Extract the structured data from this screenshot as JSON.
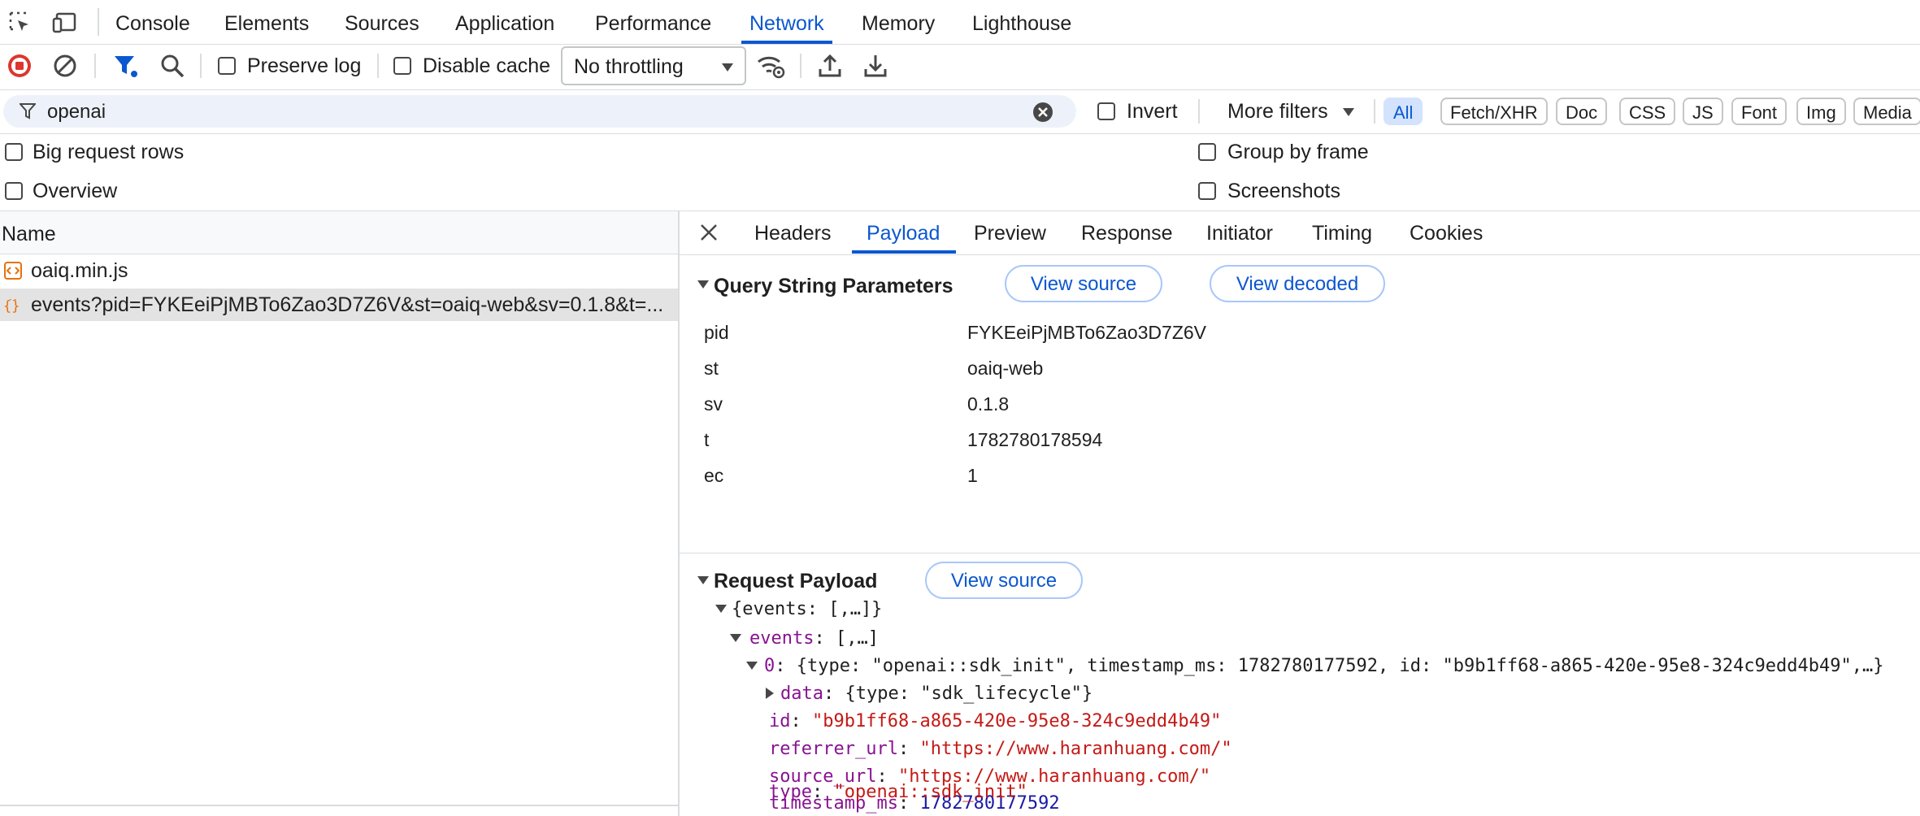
{
  "top_tabs": [
    {
      "label": "Console"
    },
    {
      "label": "Elements"
    },
    {
      "label": "Sources"
    },
    {
      "label": "Application"
    },
    {
      "label": "Performance"
    },
    {
      "label": "Network",
      "active": true
    },
    {
      "label": "Memory"
    },
    {
      "label": "Lighthouse"
    }
  ],
  "toolbar": {
    "preserve_log": "Preserve log",
    "disable_cache": "Disable cache",
    "throttling": "No throttling",
    "preserve_checked": false,
    "disable_cache_checked": false
  },
  "filter": {
    "value": "openai",
    "invert_label": "Invert",
    "more_filters_label": "More filters",
    "types": [
      "All",
      "Fetch/XHR",
      "Doc",
      "CSS",
      "JS",
      "Font",
      "Img",
      "Media"
    ],
    "active_type": "All"
  },
  "options": {
    "big_request_rows": "Big request rows",
    "overview": "Overview",
    "group_by_frame": "Group by frame",
    "screenshots": "Screenshots"
  },
  "request_list": {
    "header": "Name",
    "rows": [
      {
        "name": "oaiq.min.js",
        "selected": false
      },
      {
        "name": "events?pid=FYKEeiPjMBTo6Zao3D7Z6V&st=oaiq-web&sv=0.1.8&t=...",
        "selected": true
      }
    ]
  },
  "detail_tabs": [
    {
      "label": "Headers"
    },
    {
      "label": "Payload",
      "active": true
    },
    {
      "label": "Preview"
    },
    {
      "label": "Response"
    },
    {
      "label": "Initiator"
    },
    {
      "label": "Timing"
    },
    {
      "label": "Cookies"
    }
  ],
  "query_string": {
    "title": "Query String Parameters",
    "view_source": "View source",
    "view_decoded": "View decoded",
    "params": [
      {
        "key": "pid",
        "value": "FYKEeiPjMBTo6Zao3D7Z6V"
      },
      {
        "key": "st",
        "value": "oaiq-web"
      },
      {
        "key": "sv",
        "value": "0.1.8"
      },
      {
        "key": "t",
        "value": "1782780178594"
      },
      {
        "key": "ec",
        "value": "1"
      }
    ]
  },
  "request_payload": {
    "title": "Request Payload",
    "view_source": "View source",
    "root": "{events: [,…]}",
    "events_key": "events",
    "events_summary": "[,…]",
    "item0_key": "0",
    "item0_summary": "{type: \"openai::sdk_init\", timestamp_ms: 1782780177592, id: \"b9b1ff68-a865-420e-95e8-324c9edd4b49\",…}",
    "data_key": "data",
    "data_summary": "{type: \"sdk_lifecycle\"}",
    "fields": [
      {
        "key": "id",
        "value": "\"b9b1ff68-a865-420e-95e8-324c9edd4b49\"",
        "kind": "string"
      },
      {
        "key": "referrer_url",
        "value": "\"https://www.haranhuang.com/\"",
        "kind": "string"
      },
      {
        "key": "source_url",
        "value": "\"https://www.haranhuang.com/\"",
        "kind": "string"
      },
      {
        "key": "timestamp_ms",
        "value": "1782780177592",
        "kind": "number"
      },
      {
        "key": "type",
        "value": "\"openai::sdk_init\"",
        "kind": "string"
      }
    ]
  }
}
